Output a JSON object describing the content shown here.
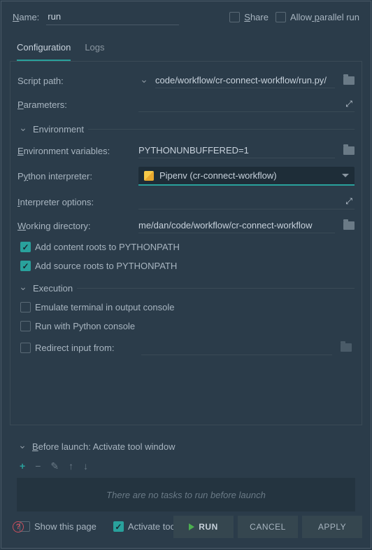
{
  "top": {
    "name_label": "Name:",
    "name_value": "run",
    "share_label": "Share",
    "allow_parallel_label": "Allow parallel run"
  },
  "tabs": {
    "configuration": "Configuration",
    "logs": "Logs"
  },
  "config": {
    "script_path_label": "Script path:",
    "script_path_value": "/code/workflow/cr-connect-workflow/run.py",
    "parameters_label": "Parameters:",
    "parameters_value": "",
    "env_section": "Environment",
    "env_vars_label": "Environment variables:",
    "env_vars_value": "PYTHONUNBUFFERED=1",
    "python_interp_label": "Python interpreter:",
    "python_interp_value": "Pipenv (cr-connect-workflow)",
    "interp_options_label": "Interpreter options:",
    "interp_options_value": "",
    "working_dir_label": "Working directory:",
    "working_dir_value": "me/dan/code/workflow/cr-connect-workflow",
    "add_content_roots": "Add content roots to PYTHONPATH",
    "add_source_roots": "Add source roots to PYTHONPATH",
    "exec_section": "Execution",
    "emulate_terminal": "Emulate terminal in output console",
    "run_with_console": "Run with Python console",
    "redirect_input": "Redirect input from:",
    "redirect_value": ""
  },
  "before_launch": {
    "title": "Before launch: Activate tool window",
    "empty_text": "There are no tasks to run before launch",
    "show_page": "Show this page",
    "activate_tool": "Activate tool window"
  },
  "footer": {
    "run": "RUN",
    "cancel": "CANCEL",
    "apply": "APPLY"
  }
}
